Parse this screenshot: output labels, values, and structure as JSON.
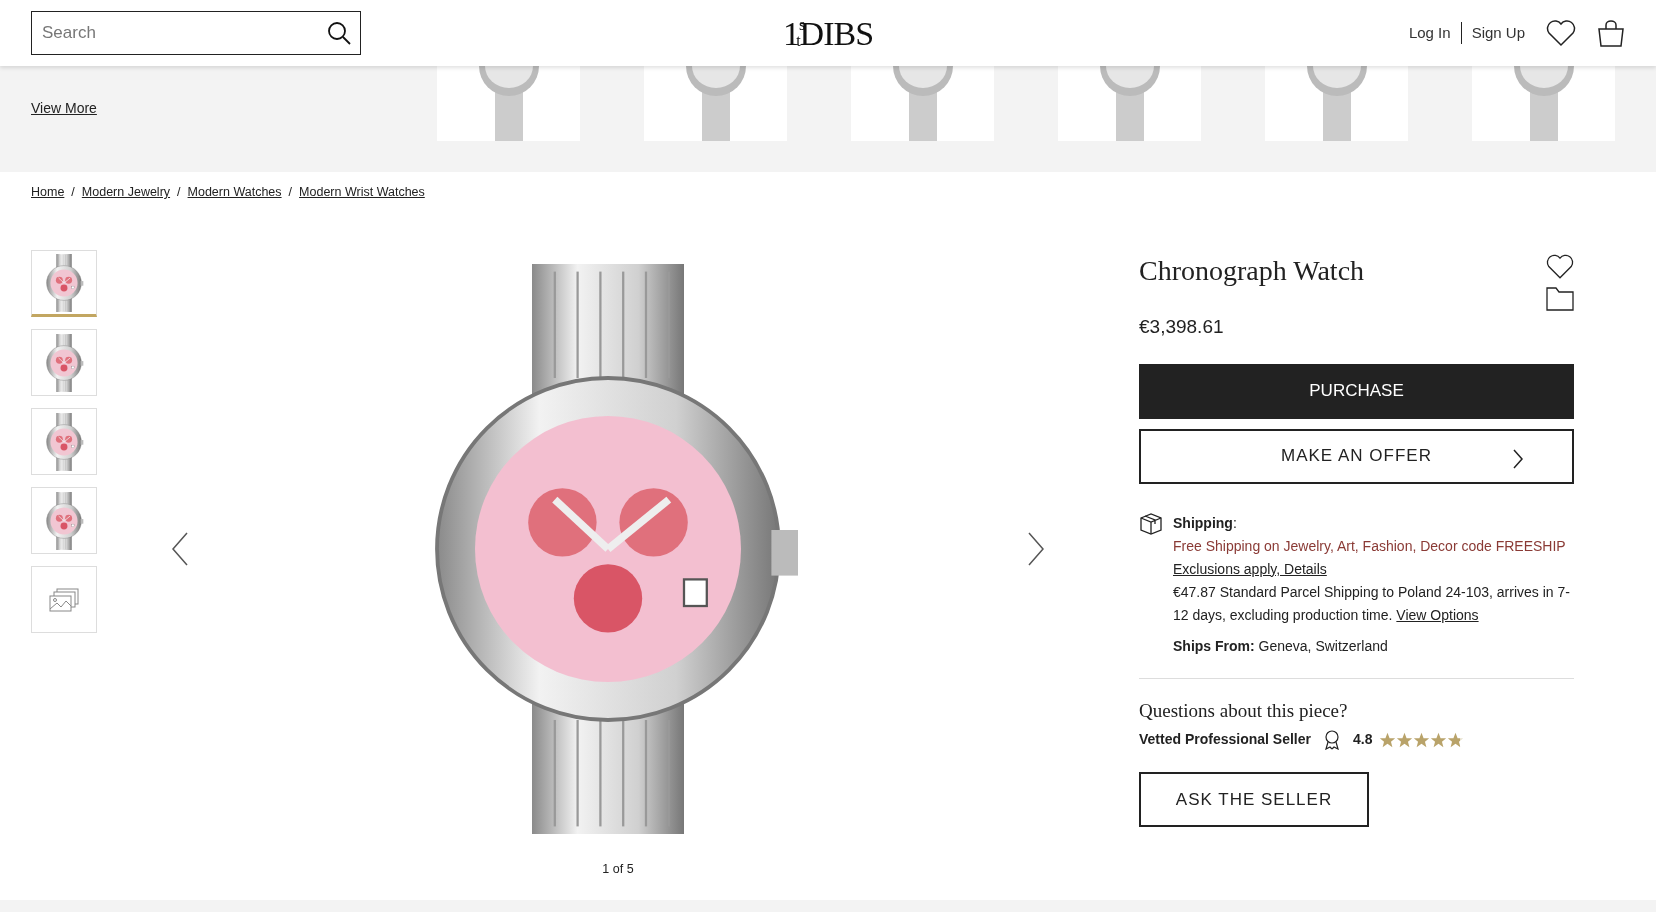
{
  "header": {
    "search": {
      "placeholder": "Search"
    },
    "logo": "1$^{s}$$_{t}$DIBS",
    "links": [
      "Log In",
      "Sign Up"
    ]
  },
  "related": {
    "view_more": "View More"
  },
  "breadcrumb": {
    "items": [
      "Home",
      "Modern Jewelry",
      "Modern Watches",
      "Modern Wrist Watches"
    ],
    "separators": [
      "/",
      "/",
      "/"
    ]
  },
  "gallery": {
    "thumbnails": [
      {
        "kind": "photo",
        "selected": true
      },
      {
        "kind": "photo",
        "selected": false
      },
      {
        "kind": "photo",
        "selected": false
      },
      {
        "kind": "photo",
        "selected": false
      },
      {
        "kind": "more",
        "selected": false
      }
    ],
    "counter": "1 of 5"
  },
  "product": {
    "title": "Chronograph Watch",
    "price": "€3,398.61",
    "purchase": "PURCHASE",
    "offer": "MAKE AN OFFER",
    "shipping": {
      "label": "**Shipping**:",
      "promo": "Free Shipping on Jewelry, Art, Fashion, Decor code FREESHIP",
      "promo_link": "Exclusions apply, Details",
      "rate": "€47.87 Standard Parcel Shipping to Poland 24-103, arrives in 7-12 days, excluding production time.",
      "rate_link": "View Options",
      "ships_from": "**Ships From:** Geneva, Switzerland"
    },
    "seller": {
      "question": "Questions about this piece?",
      "label": "Vetted Professional Seller",
      "rating": "4.8",
      "stars": 4.8,
      "button": "ASK THE SELLER"
    }
  }
}
